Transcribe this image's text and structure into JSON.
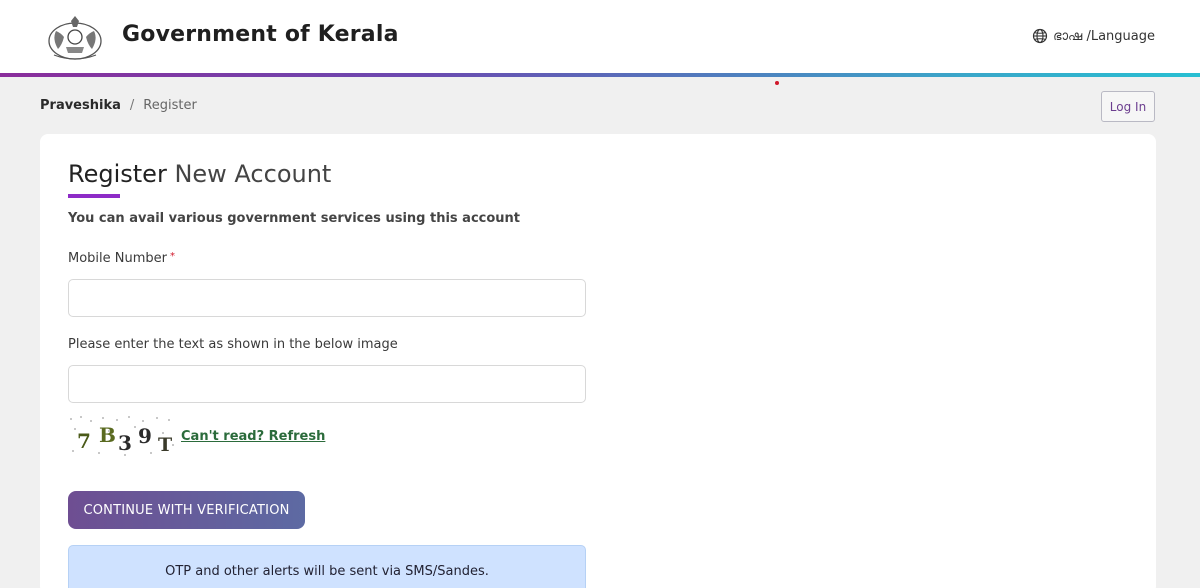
{
  "header": {
    "site_title": "Government of Kerala",
    "language_label": "ഭാഷ /Language",
    "accent_gradient": [
      "#8a2d9b",
      "#27bfd2"
    ]
  },
  "breadcrumb": {
    "home": "Praveshika",
    "separator": "/",
    "current": "Register"
  },
  "login_button": "Log In",
  "form": {
    "title_part1": "Register",
    "title_part2": "New Account",
    "subtitle": "You can avail various government services using this account",
    "mobile_label": "Mobile Number",
    "mobile_required_mark": "*",
    "mobile_value": "",
    "captcha_prompt": "Please enter the text as shown in the below image",
    "captcha_value": "",
    "captcha_chars": [
      "7",
      "B",
      "3",
      "9",
      "T"
    ],
    "captcha_refresh": "Can't read? Refresh",
    "continue_button": "CONTINUE WITH VERIFICATION",
    "alert_text": "OTP and other alerts will be sent via SMS/Sandes."
  },
  "colors": {
    "accent_purple": "#8e2bc7",
    "button_start": "#6e4e92",
    "button_end": "#5d6aa3",
    "alert_bg": "#cfe2ff",
    "required": "#d0182b"
  }
}
